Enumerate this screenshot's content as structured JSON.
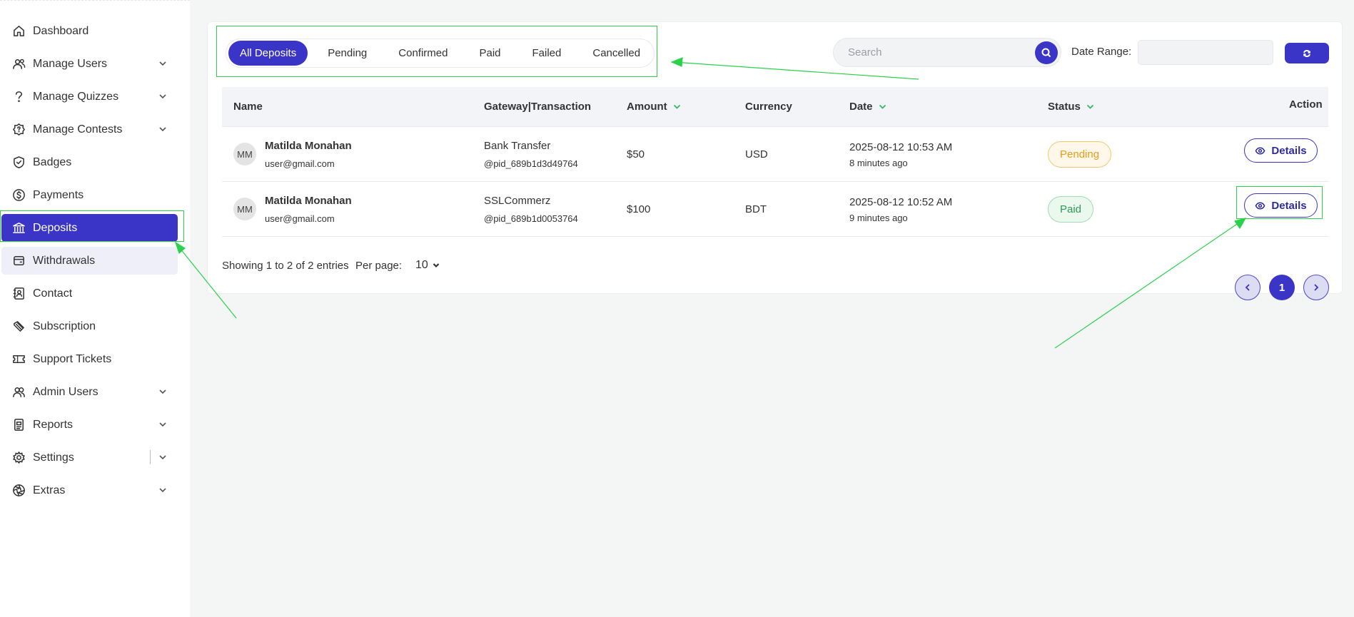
{
  "sidebar": {
    "items": [
      {
        "label": "Dashboard",
        "icon": "home-icon",
        "chevron": false
      },
      {
        "label": "Manage Users",
        "icon": "users-icon",
        "chevron": true
      },
      {
        "label": "Manage Quizzes",
        "icon": "question-icon",
        "chevron": true
      },
      {
        "label": "Manage Contests",
        "icon": "badge-question-icon",
        "chevron": true
      },
      {
        "label": "Badges",
        "icon": "shield-check-icon",
        "chevron": false
      },
      {
        "label": "Payments",
        "icon": "dollar-circle-icon",
        "chevron": false
      },
      {
        "label": "Deposits",
        "icon": "bank-icon",
        "chevron": false,
        "active": true
      },
      {
        "label": "Withdrawals",
        "icon": "wallet-icon",
        "chevron": false
      },
      {
        "label": "Contact",
        "icon": "contact-book-icon",
        "chevron": false
      },
      {
        "label": "Subscription",
        "icon": "subscription-icon",
        "chevron": false
      },
      {
        "label": "Support Tickets",
        "icon": "ticket-icon",
        "chevron": false
      },
      {
        "label": "Admin Users",
        "icon": "admin-users-icon",
        "chevron": true
      },
      {
        "label": "Reports",
        "icon": "report-icon",
        "chevron": true
      },
      {
        "label": "Settings",
        "icon": "gear-icon",
        "chevron": true
      },
      {
        "label": "Extras",
        "icon": "aperture-icon",
        "chevron": true
      }
    ]
  },
  "filters": {
    "tabs": [
      "All Deposits",
      "Pending",
      "Confirmed",
      "Paid",
      "Failed",
      "Cancelled"
    ],
    "active_tab": "All Deposits",
    "search_placeholder": "Search",
    "date_range_label": "Date Range:",
    "date_range_value": ""
  },
  "table": {
    "headers": {
      "name": "Name",
      "gateway": "Gateway|Transaction",
      "amount": "Amount",
      "currency": "Currency",
      "date": "Date",
      "status": "Status",
      "action": "Action"
    },
    "rows": [
      {
        "initials": "MM",
        "name": "Matilda Monahan",
        "email": "user@gmail.com",
        "gateway": "Bank Transfer",
        "transaction": "@pid_689b1d3d49764",
        "amount": "$50",
        "currency": "USD",
        "date": "2025-08-12 10:53 AM",
        "ago": "8 minutes ago",
        "status": "Pending",
        "action": "Details"
      },
      {
        "initials": "MM",
        "name": "Matilda Monahan",
        "email": "user@gmail.com",
        "gateway": "SSLCommerz",
        "transaction": "@pid_689b1d0053764",
        "amount": "$100",
        "currency": "BDT",
        "date": "2025-08-12 10:52 AM",
        "ago": "9 minutes ago",
        "status": "Paid",
        "action": "Details"
      }
    ]
  },
  "footer": {
    "showing": "Showing 1 to 2 of 2 entries",
    "per_page_label": "Per page:",
    "per_page_value": "10",
    "current_page": "1"
  },
  "colors": {
    "accent": "#3a35c6",
    "sort_indicator": "#2fb86a",
    "annotation": "#2bd14b",
    "pending": "#e89d17",
    "paid": "#2a9c53"
  }
}
